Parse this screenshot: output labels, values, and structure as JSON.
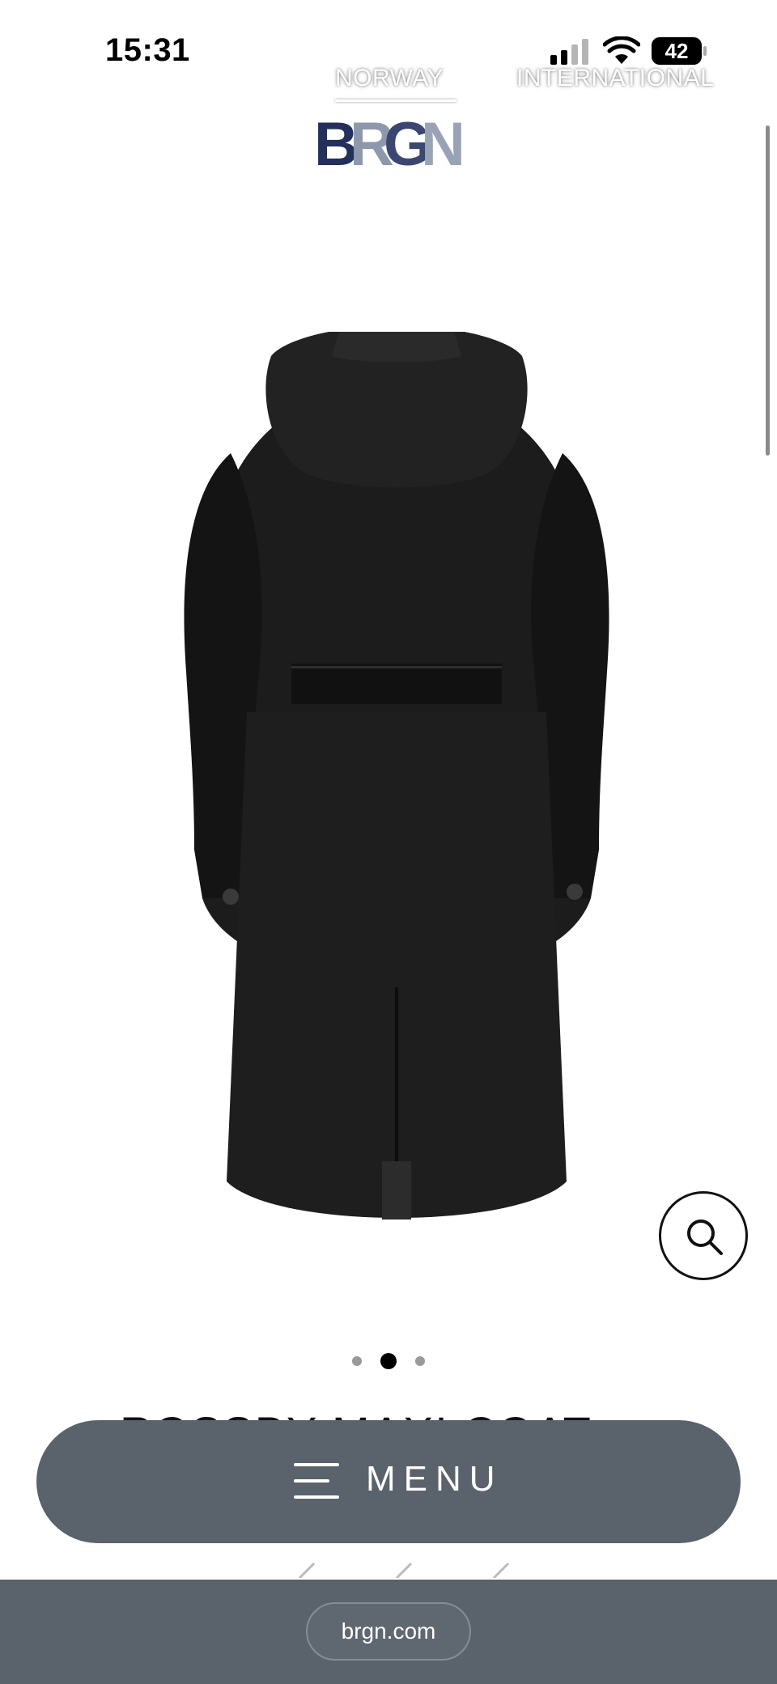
{
  "status_bar": {
    "time": "15:31",
    "battery": "42"
  },
  "header": {
    "region_links": [
      "NORWAY",
      "INTERNATIONAL"
    ],
    "logo_text": "BRGN",
    "colors": {
      "logo_navy": "#22305a",
      "logo_gray": "#9aa3b6"
    }
  },
  "product": {
    "image_alt_icon": "coat-back-view",
    "title": "ROSSBY MAXI COAT"
  },
  "carousel": {
    "total": 3,
    "active_index": 1
  },
  "zoom": {
    "icon": "search-icon"
  },
  "menu": {
    "label": "MENU",
    "icon": "hamburger-icon"
  },
  "browser": {
    "url": "brgn.com"
  },
  "colors": {
    "menu_bg": "#5a626b",
    "browser_bg": "#5a626b"
  }
}
